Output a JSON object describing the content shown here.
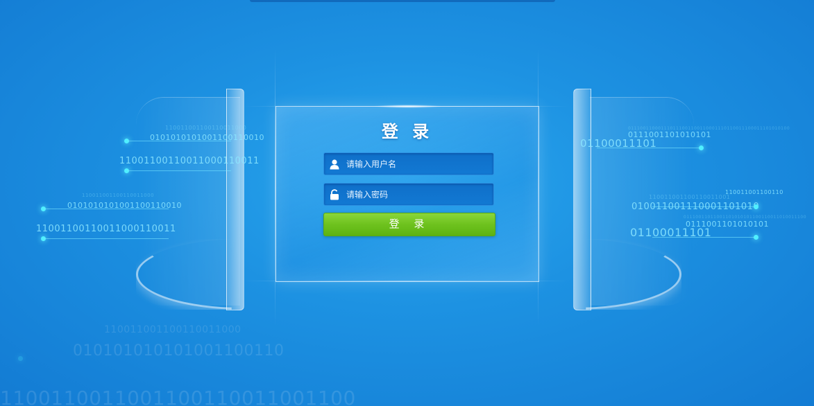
{
  "login": {
    "title": "登 录",
    "username_placeholder": "请输入用户名",
    "password_placeholder": "请输入密码",
    "submit_label": "登 录"
  },
  "decor": {
    "left_lines": [
      "110011001100110011000",
      "0101010101001100110010",
      "11001100110011000110011",
      "11001100110011000110011",
      "0101010101001100110010",
      "110011001100110011000",
      "110011001100110011000",
      "010101010101001100110",
      "1100110011001100110011001100"
    ],
    "right_lines": [
      "011100110001110111001100110001110110011100011101010100",
      "0111001101010101",
      "01100011101",
      "110011001100110",
      "110011001100110011001",
      "010011001110001101010",
      "01110011011001101010101100110011010011100",
      "0111001101010101",
      "01100011101"
    ]
  },
  "colors": {
    "accent_green": "#6ec21e",
    "field_blue": "#1279d3",
    "background": "#1d92e2"
  }
}
